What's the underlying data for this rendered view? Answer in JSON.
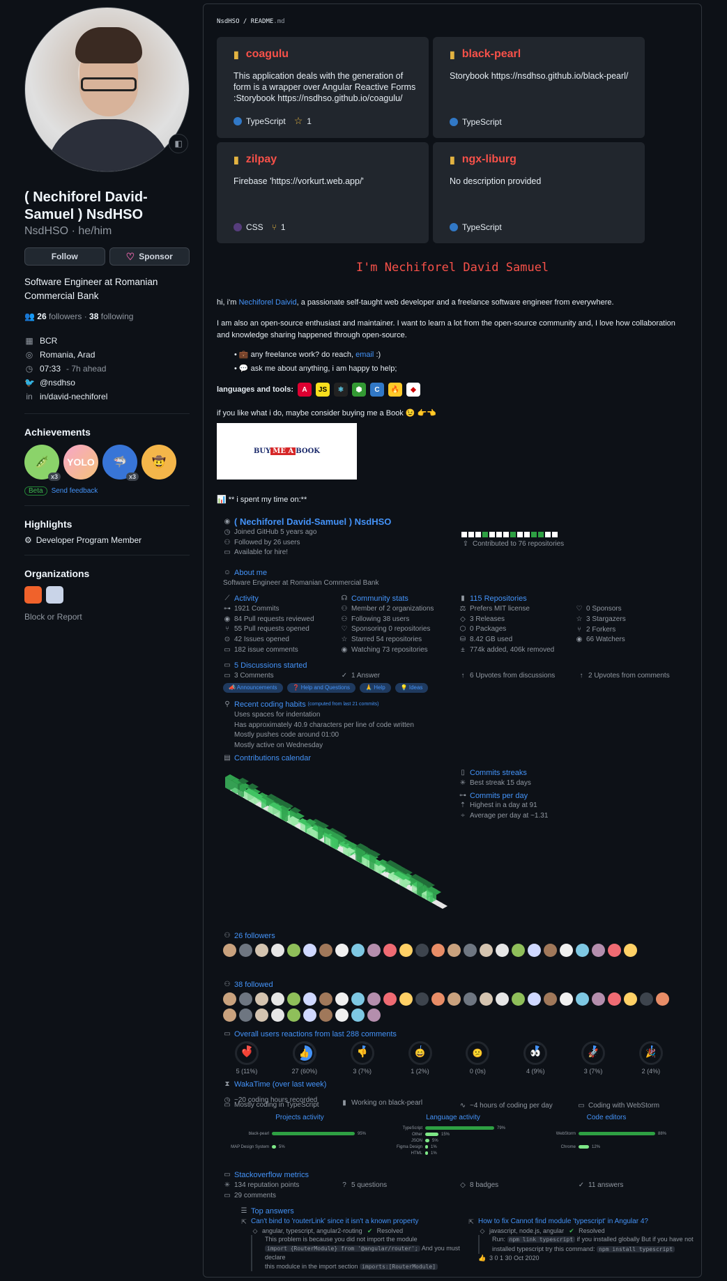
{
  "profile": {
    "fullname": "( Nechiforel David-Samuel ) NsdHSO",
    "login": "NsdHSO",
    "pronouns": "he/him",
    "follow_label": "Follow",
    "sponsor_label": "Sponsor",
    "bio": "Software Engineer at Romanian Commercial Bank",
    "followers": "26",
    "followers_label": "followers",
    "following": "38",
    "following_label": "following",
    "company": "BCR",
    "location": "Romania, Arad",
    "time": "07:33",
    "time_note": "- 7h ahead",
    "twitter": "@nsdhso",
    "linkedin": "in/david-nechiforel",
    "achievements_title": "Achievements",
    "badge_count": "x3",
    "beta_label": "Beta",
    "feedback_label": "Send feedback",
    "highlights_title": "Highlights",
    "highlight_item": "Developer Program Member",
    "organizations_title": "Organizations",
    "block_label": "Block or Report"
  },
  "readme": {
    "crumb_user": "NsdHSO",
    "crumb_sep": " / ",
    "crumb_file": "README",
    "crumb_ext": ".md",
    "pins": [
      {
        "name": "coagulu",
        "desc": "This application deals with the generation of form is a wrapper over Angular Reactive Forms :Storybook https://nsdhso.github.io/coagulu/",
        "lang": "TypeScript",
        "lang_color": "#3178c6",
        "extra": "1"
      },
      {
        "name": "black-pearl",
        "desc": "Storybook https://nsdhso.github.io/black-pearl/",
        "lang": "TypeScript",
        "lang_color": "#3178c6",
        "extra": ""
      },
      {
        "name": "zilpay",
        "desc": "Firebase 'https://vorkurt.web.app/'",
        "lang": "CSS",
        "lang_color": "#563d7c",
        "extra": "1"
      },
      {
        "name": "ngx-liburg",
        "desc": "No description provided",
        "lang": "TypeScript",
        "lang_color": "#3178c6",
        "extra": ""
      }
    ],
    "hello": "I'm Nechiforel David Samuel",
    "intro_pre": "hi, i'm ",
    "intro_link": "Nechiforel Daivid",
    "intro_post": ", a passionate self-taught web developer and a freelance software engineer from everywhere.",
    "para2": "I am also an open-source enthusiast and maintainer. I want to learn a lot from the open-source community and, I love how collaboration and knowledge sharing happened through open-source.",
    "bullet1_pre": "💼 any freelance work? do reach, ",
    "bullet1_link": "email",
    "bullet1_post": " :)",
    "bullet2": "💬 ask me about anything, i am happy to help;",
    "languages_label": "languages and tools:",
    "book_text": "if you like what i do, maybe consider buying me a Book 😉 👉👈",
    "book_btn_1": "BUY ",
    "book_btn_me": "ME A",
    "book_btn_2": " BOOK",
    "time_text": "📊 ** i spent my time on:**"
  },
  "metrics": {
    "name": "( Nechiforel David-Samuel ) NsdHSO",
    "joined": "Joined GitHub 5 years ago",
    "followed_by": "Followed by 26 users",
    "available": "Available for hire!",
    "contributed": "Contributed to 76 repositories",
    "about_title": "About me",
    "about_text": "Software Engineer at Romanian Commercial Bank",
    "activity_title": "Activity",
    "activity": [
      "1921 Commits",
      "84 Pull requests reviewed",
      "55 Pull requests opened",
      "42 Issues opened",
      "182 issue comments"
    ],
    "community_title": "Community stats",
    "community": [
      "Member of 2 organizations",
      "Following 38 users",
      "Sponsoring 0 repositories",
      "Starred 54 repositories",
      "Watching 73 repositories"
    ],
    "repos_title": "115 Repositories",
    "repos": [
      "Prefers MIT license",
      "3 Releases",
      "0 Packages",
      "8.42 GB used",
      "774k added, 406k removed"
    ],
    "repos2": [
      "0 Sponsors",
      "3 Stargazers",
      "2 Forkers",
      "66 Watchers"
    ],
    "discussions_title": "5 Discussions started",
    "discussions": [
      "3 Comments",
      "1 Answer",
      "6 Upvotes from discussions",
      "2 Upvotes from comments"
    ],
    "discussion_tags": [
      "📣 Announcements",
      "❓ Help and Questions",
      "🙏 Help",
      "💡 Ideas"
    ],
    "habits_title": "Recent coding habits",
    "habits_note": "(computed from last 21 commits)",
    "habits": [
      "Uses spaces for indentation",
      "Has approximately 40.9 characters per line of code written",
      "Mostly pushes code around 01:00",
      "Mostly active on Wednesday"
    ],
    "calendar_title": "Contributions calendar",
    "streaks_title": "Commits streaks",
    "best_streak": "Best streak 15 days",
    "per_day_title": "Commits per day",
    "highest": "Highest in a day at 91",
    "average": "Average per day at ~1.31",
    "followers_title": "26 followers",
    "followed_title": "38 followed",
    "reactions_title": "Overall users reactions from last 288 comments",
    "reactions": [
      {
        "emoji": "❤️",
        "count": "5",
        "pct": "(11%)",
        "color": "#f85149",
        "fill": 0.11
      },
      {
        "emoji": "👍",
        "count": "27",
        "pct": "(60%)",
        "color": "#4493f8",
        "fill": 0.6
      },
      {
        "emoji": "👎",
        "count": "3",
        "pct": "(7%)",
        "color": "#4493f8",
        "fill": 0.07
      },
      {
        "emoji": "😄",
        "count": "1",
        "pct": "(2%)",
        "color": "#4493f8",
        "fill": 0.02
      },
      {
        "emoji": "😕",
        "count": "0",
        "pct": "(0s)",
        "color": "#4493f8",
        "fill": 0
      },
      {
        "emoji": "👀",
        "count": "4",
        "pct": "(9%)",
        "color": "#4493f8",
        "fill": 0.09
      },
      {
        "emoji": "🚀",
        "count": "3",
        "pct": "(7%)",
        "color": "#4493f8",
        "fill": 0.07
      },
      {
        "emoji": "🎉",
        "count": "2",
        "pct": "(4%)",
        "color": "#4493f8",
        "fill": 0.04
      }
    ],
    "waka_title": "WakaTime (over last week)",
    "waka": [
      "~20 coding hours recorded",
      "Mostly coding in TypeScript",
      "Working on black-pearl",
      "~4 hours of coding per day",
      "Coding with WebStorm"
    ],
    "projects_title": "Projects activity",
    "projects": [
      {
        "name": "black-pearl",
        "pct": "95%",
        "v": 0.95
      },
      {
        "name": "MAP Design System",
        "pct": "5%",
        "v": 0.05
      }
    ],
    "languages_title": "Language activity",
    "languages": [
      {
        "name": "TypeScript",
        "pct": "79%",
        "v": 0.79
      },
      {
        "name": "Other",
        "pct": "15%",
        "v": 0.15
      },
      {
        "name": "JSON",
        "pct": "5%",
        "v": 0.05
      },
      {
        "name": "Figma Design",
        "pct": "1%",
        "v": 0.01
      },
      {
        "name": "HTML",
        "pct": "1%",
        "v": 0.01
      }
    ],
    "editors_title": "Code editors",
    "editors": [
      {
        "name": "WebStorm",
        "pct": "88%",
        "v": 0.88
      },
      {
        "name": "Chrome",
        "pct": "12%",
        "v": 0.12
      }
    ],
    "so_title": "Stackoverflow metrics",
    "so": [
      "134 reputation points",
      "5 questions",
      "8 badges",
      "11 answers",
      "29 comments"
    ],
    "top_answers_title": "Top answers",
    "answers": [
      {
        "title": "Can't bind to 'routerLink' since it isn't a known property",
        "tags": "angular, typescript, angular2-routing",
        "resolved": "Resolved",
        "line1": "This problem is because you did not import the module",
        "code1": "import {RouterModule} from '@angular/router';",
        "line2": " And you must declare",
        "line3": "this modulce in the import section ",
        "code2": "imports:[RouterModule]"
      },
      {
        "title": "How to fix Cannot find module 'typescript' in Angular 4?",
        "tags": "javascript, node.js, angular",
        "resolved": "Resolved",
        "line1": "Run: ",
        "code1": "npm link typescript",
        "line2": " if you installed globally But if you have not",
        "line3": "installed typescript try this command: ",
        "code2": "npm install typescript",
        "stats": "3   0   1   30 Oct 2020"
      }
    ]
  }
}
